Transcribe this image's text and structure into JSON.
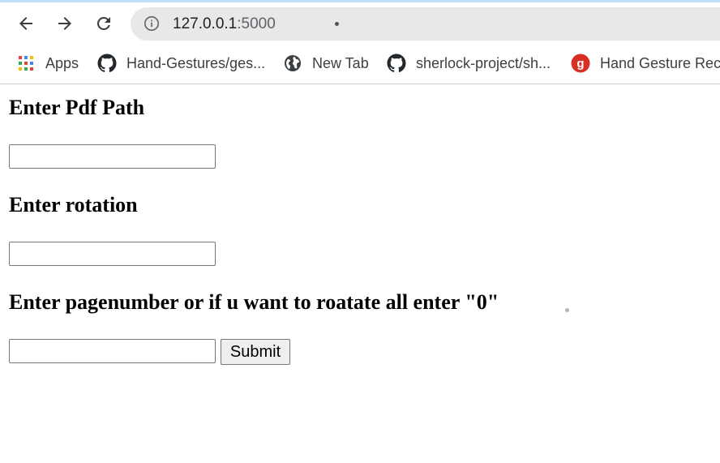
{
  "browser": {
    "url_host": "127.0.0.1",
    "url_port": ":5000",
    "icons": {
      "back": "arrow-left-icon",
      "forward": "arrow-right-icon",
      "reload": "reload-icon",
      "site_info": "info-circle-icon"
    }
  },
  "bookmarks": [
    {
      "label": "Apps",
      "icon": "apps-grid-icon"
    },
    {
      "label": "Hand-Gestures/ges...",
      "icon": "github-icon"
    },
    {
      "label": "New Tab",
      "icon": "globe-icon"
    },
    {
      "label": "sherlock-project/sh...",
      "icon": "github-icon"
    },
    {
      "label": "Hand Gesture Reco",
      "icon": "g-red-icon"
    }
  ],
  "form": {
    "pdf_path_heading": "Enter Pdf Path",
    "rotation_heading": "Enter rotation",
    "page_heading": "Enter pagenumber or if u want to roatate all enter \"0\"",
    "pdf_path_value": "",
    "rotation_value": "",
    "page_value": "",
    "submit_label": "Submit"
  },
  "colors": {
    "omnibox_bg": "#e8e8e9",
    "google_red": "#d93025"
  }
}
